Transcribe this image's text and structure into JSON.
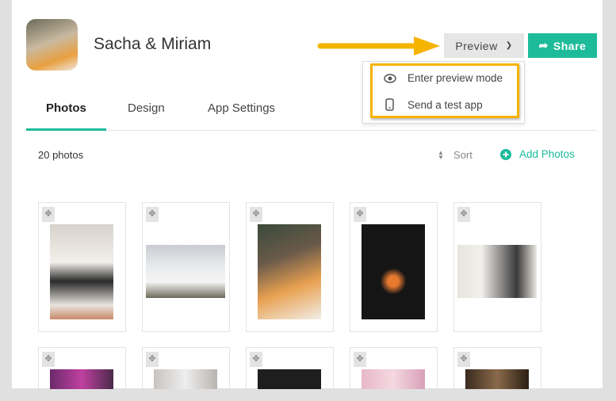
{
  "header": {
    "title": "Sacha & Miriam",
    "preview_label": "Preview",
    "share_label": "Share"
  },
  "preview_menu": [
    {
      "icon": "eye-icon",
      "label": "Enter preview mode"
    },
    {
      "icon": "phone-icon",
      "label": "Send a test app"
    }
  ],
  "tabs": [
    {
      "label": "Photos",
      "active": true
    },
    {
      "label": "Design"
    },
    {
      "label": "App Settings"
    }
  ],
  "toolbar": {
    "count": "20 photos",
    "sort_label": "Sort",
    "add_label": "Add Photos"
  },
  "colors": {
    "accent": "#1dbb9a",
    "highlight": "#f5b400"
  }
}
